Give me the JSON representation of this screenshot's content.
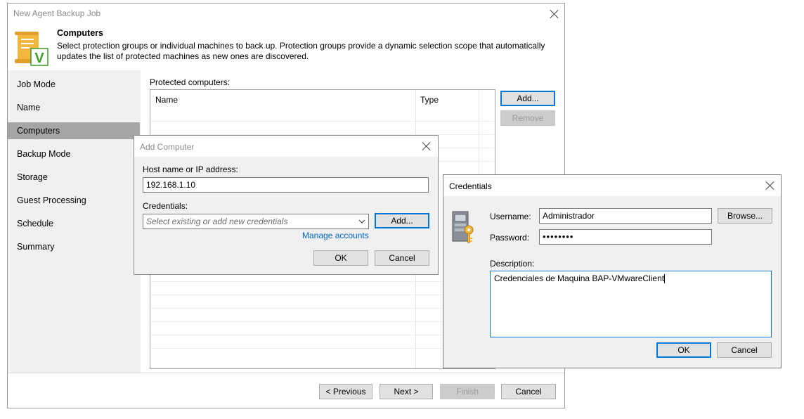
{
  "main_window": {
    "title": "New Agent Backup Job",
    "header_title": "Computers",
    "header_description_line1": "Select protection groups or individual machines to back up. Protection groups provide a dynamic selection scope that automatically",
    "header_description_line2": "updates the list of protected machines as new ones are discovered."
  },
  "sidebar": {
    "items": [
      {
        "label": "Job Mode"
      },
      {
        "label": "Name"
      },
      {
        "label": "Computers",
        "active": true
      },
      {
        "label": "Backup Mode"
      },
      {
        "label": "Storage"
      },
      {
        "label": "Guest Processing"
      },
      {
        "label": "Schedule"
      },
      {
        "label": "Summary"
      }
    ]
  },
  "protected": {
    "label": "Protected computers:",
    "columns": [
      "Name",
      "Type"
    ],
    "add_label": "Add...",
    "remove_label": "Remove"
  },
  "footer": {
    "previous_label": "< Previous",
    "next_label": "Next >",
    "finish_label": "Finish",
    "cancel_label": "Cancel"
  },
  "add_computer": {
    "title": "Add Computer",
    "host_label": "Host name or IP address:",
    "host_value": "192.168.1.10",
    "credentials_label": "Credentials:",
    "credentials_placeholder": "Select existing or add new credentials",
    "add_label": "Add...",
    "manage_accounts": "Manage accounts",
    "ok_label": "OK",
    "cancel_label": "Cancel"
  },
  "credentials": {
    "title": "Credentials",
    "username_label": "Username:",
    "username_value": "Administrador",
    "browse_label": "Browse...",
    "password_label": "Password:",
    "password_masked": "••••••••",
    "description_label": "Description:",
    "description_value": "Credenciales de Maquina BAP-VMwareClient",
    "ok_label": "OK",
    "cancel_label": "Cancel"
  },
  "colors": {
    "accent": "#0078d7",
    "link": "#0066cc",
    "active_nav": "#a6a6a6",
    "sidebar_bg": "#f0f0f0",
    "logo_yellow": "#f3b73e",
    "logo_green": "#3f9b2c"
  },
  "icons": [
    "close-icon",
    "job-scroll-icon",
    "chevron-down-icon",
    "credentials-key-icon"
  ]
}
